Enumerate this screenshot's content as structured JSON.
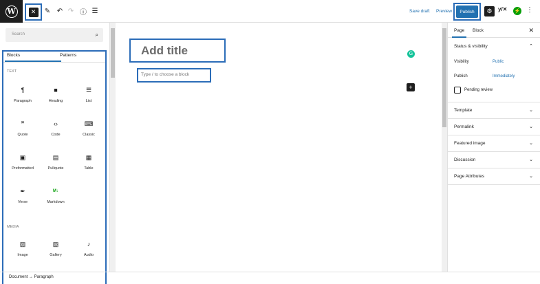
{
  "toolbar": {
    "wp_logo": "W",
    "close_icon": "✕",
    "save_draft": "Save draft",
    "preview": "Preview",
    "publish": "Publish",
    "yoast": "y/✕",
    "jetpack": "⚡"
  },
  "inserter": {
    "search_placeholder": "Search",
    "tabs": [
      "Blocks",
      "Patterns"
    ],
    "category_text": "TEXT",
    "category_media": "MEDIA",
    "text_blocks": [
      {
        "label": "Paragraph",
        "icon": "¶"
      },
      {
        "label": "Heading",
        "icon": "🔖"
      },
      {
        "label": "List",
        "icon": "☰"
      },
      {
        "label": "Quote",
        "icon": "❞"
      },
      {
        "label": "Code",
        "icon": "‹›"
      },
      {
        "label": "Classic",
        "icon": "⌨"
      },
      {
        "label": "Preformatted",
        "icon": "▣"
      },
      {
        "label": "Pullquote",
        "icon": "▤"
      },
      {
        "label": "Table",
        "icon": "▦"
      },
      {
        "label": "Verse",
        "icon": "✒"
      },
      {
        "label": "Markdown",
        "icon": "M↓"
      }
    ],
    "media_blocks": [
      {
        "label": "Image",
        "icon": "▨"
      },
      {
        "label": "Gallery",
        "icon": "▧"
      },
      {
        "label": "Audio",
        "icon": "♪"
      }
    ]
  },
  "canvas": {
    "title_placeholder": "Add title",
    "paragraph_placeholder": "Type / to choose a block"
  },
  "sidebar": {
    "tabs": [
      "Page",
      "Block"
    ],
    "status_title": "Status & visibility",
    "visibility_label": "Visibility",
    "visibility_value": "Public",
    "publish_label": "Publish",
    "publish_value": "Immediately",
    "pending_review": "Pending review",
    "sections": [
      "Template",
      "Permalink",
      "Featured image",
      "Discussion",
      "Page Attributes"
    ]
  },
  "footer": {
    "breadcrumb": "Document → Paragraph"
  },
  "colors": {
    "accent": "#2271b1",
    "highlight_border": "#2b6cb8",
    "dark": "#1e1e1e"
  }
}
